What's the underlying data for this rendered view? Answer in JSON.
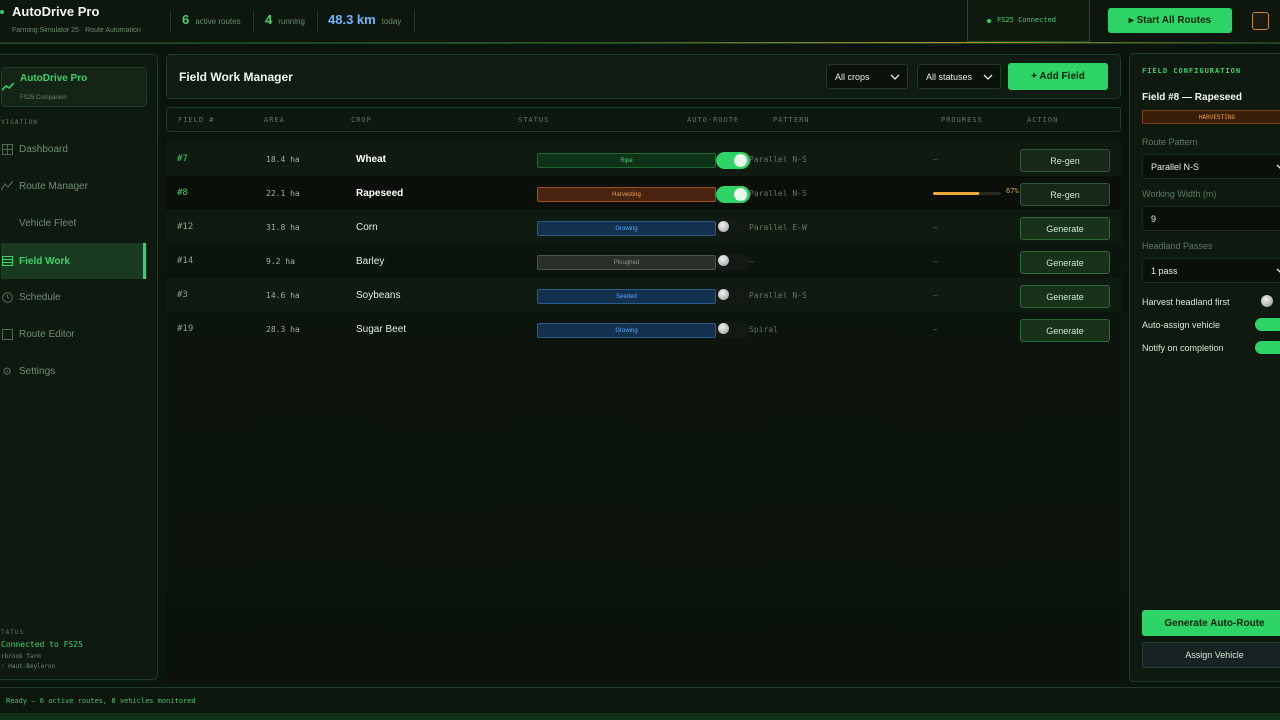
{
  "topbar": {
    "title": "AutoDrive Pro",
    "subtitle": "Farming Simulator 25  ·  Route Automation",
    "stats": [
      {
        "value": "6",
        "label": "active routes"
      },
      {
        "value": "4",
        "label": "running"
      },
      {
        "value": "48.3 km",
        "label": "today"
      }
    ],
    "connection": "FS25  Connected",
    "start_all": "▸ Start All Routes"
  },
  "sidebar": {
    "brand_title": "AutoDrive Pro",
    "brand_sub": "FS25 Companion",
    "nav_heading": "VIGATION",
    "items": [
      {
        "label": "Dashboard",
        "icon": "grid-icon"
      },
      {
        "label": "Route Manager",
        "icon": "route-icon"
      },
      {
        "label": "Vehicle Fleet",
        "icon": "tractor-icon"
      },
      {
        "label": "Field Work",
        "icon": "list-icon"
      },
      {
        "label": "Schedule",
        "icon": "clock-icon"
      },
      {
        "label": "Route Editor",
        "icon": "edit-icon"
      },
      {
        "label": "Settings",
        "icon": "gear-icon"
      }
    ],
    "status_heading": "TATUS",
    "status_line1": "Connected to FS25",
    "status_line2": "rbrook farm",
    "status_line3": ": Haut-Beyleron"
  },
  "main": {
    "title": "Field Work Manager",
    "filter_crops": "All crops",
    "filter_status": "All statuses",
    "add_field": "+ Add Field",
    "columns": [
      "FIELD #",
      "AREA",
      "CROP",
      "STATUS",
      "AUTO-ROUTE",
      "PATTERN",
      "PROGRESS",
      "ACTION"
    ],
    "rows": [
      {
        "id": "#7",
        "area": "18.4 ha",
        "crop": "Wheat",
        "status": "Ripe",
        "auto_route": true,
        "pattern": "Parallel N-S",
        "progress": "–",
        "progress_pct": null,
        "action": "Re-gen"
      },
      {
        "id": "#8",
        "area": "22.1 ha",
        "crop": "Rapeseed",
        "status": "Harvesting",
        "auto_route": true,
        "pattern": "Parallel N-S",
        "progress": "67%",
        "progress_pct": 67,
        "action": "Re-gen"
      },
      {
        "id": "#12",
        "area": "31.8 ha",
        "crop": "Corn",
        "status": "Growing",
        "auto_route": false,
        "pattern": "Parallel E-W",
        "progress": "–",
        "progress_pct": null,
        "action": "Generate"
      },
      {
        "id": "#14",
        "area": "9.2 ha",
        "crop": "Barley",
        "status": "Ploughed",
        "auto_route": false,
        "pattern": "–",
        "progress": "–",
        "progress_pct": null,
        "action": "Generate"
      },
      {
        "id": "#3",
        "area": "14.6 ha",
        "crop": "Soybeans",
        "status": "Seeded",
        "auto_route": false,
        "pattern": "Parallel N-S",
        "progress": "–",
        "progress_pct": null,
        "action": "Generate"
      },
      {
        "id": "#19",
        "area": "28.3 ha",
        "crop": "Sugar Beet",
        "status": "Growing",
        "auto_route": false,
        "pattern": "Spiral",
        "progress": "–",
        "progress_pct": null,
        "action": "Generate"
      }
    ]
  },
  "config": {
    "heading": "FIELD CONFIGURATION",
    "title": "Field #8 — Rapeseed",
    "badge": "HARVESTING",
    "route_pattern_label": "Route Pattern",
    "route_pattern_value": "Parallel N-S",
    "width_label": "Working Width (m)",
    "width_value": "9",
    "headland_label": "Headland Passes",
    "headland_value": "1 pass",
    "harvest_first": "Harvest headland first",
    "harvest_first_on": false,
    "auto_assign": "Auto-assign vehicle",
    "auto_assign_on": true,
    "notify": "Notify on completion",
    "notify_on": true,
    "generate": "Generate Auto-Route",
    "assign": "Assign Vehicle"
  },
  "footer": {
    "status": "Ready — 6 active routes, 8 vehicles monitored"
  },
  "colors": {
    "accent": "#2fd466",
    "ripe_bg": "#0f3318",
    "ripe_fg": "#43d26a",
    "harvest_bg": "#4a2410",
    "harvest_fg": "#f0a040",
    "growing_bg": "#13304f",
    "growing_fg": "#5fa8ff",
    "ploughed_bg": "#283029",
    "ploughed_fg": "#8a968c",
    "seeded_bg": "#13304f",
    "seeded_fg": "#5fa8ff"
  }
}
